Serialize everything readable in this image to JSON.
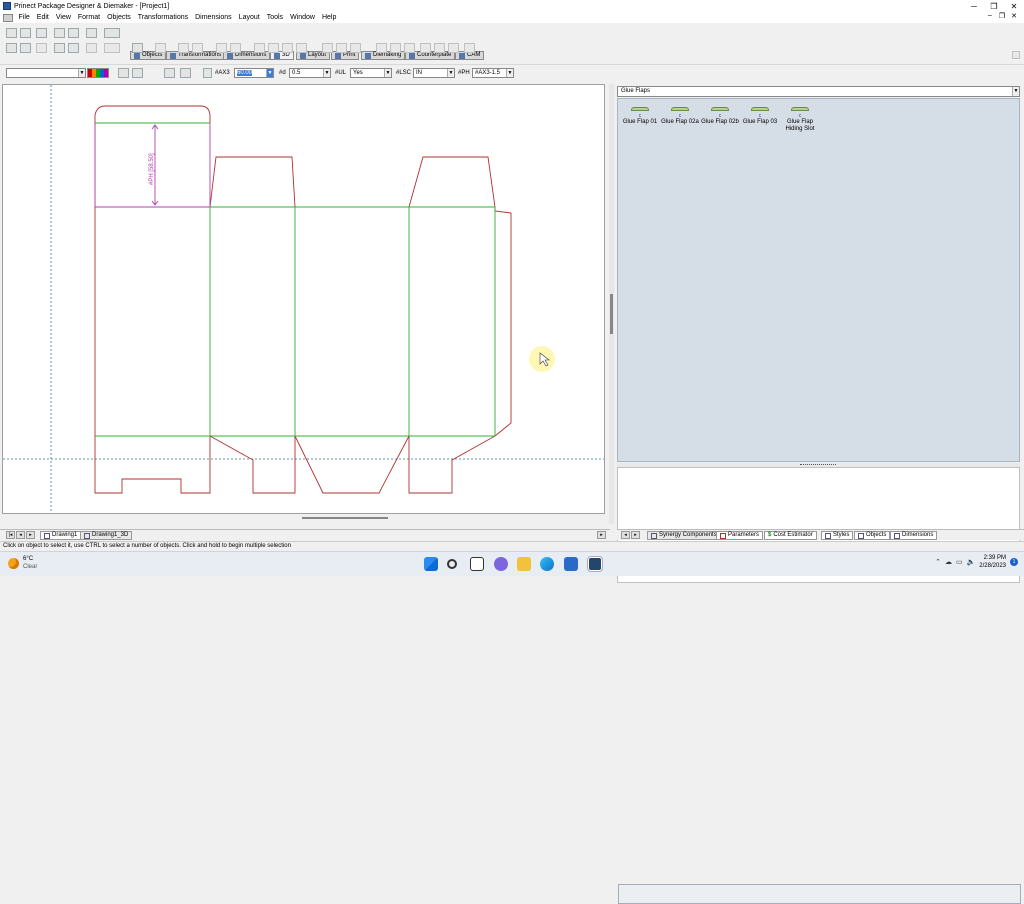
{
  "window": {
    "title": "Prinect Package Designer & Diemaker - [Project1]",
    "controls": [
      "─",
      "❐",
      "✕"
    ]
  },
  "menubar": {
    "items": [
      "File",
      "Edit",
      "View",
      "Format",
      "Objects",
      "Transformations",
      "Dimensions",
      "Layout",
      "Tools",
      "Window",
      "Help"
    ],
    "mdi_controls": [
      "–",
      "❐",
      "✕"
    ]
  },
  "ribbon_tabs": [
    {
      "label": "Objects",
      "icon": "objects-icon"
    },
    {
      "label": "Transformations",
      "icon": "transformations-icon"
    },
    {
      "label": "Dimensions",
      "icon": "dimensions-icon"
    },
    {
      "label": "3D",
      "icon": "3d-icon"
    },
    {
      "label": "Layout",
      "icon": "layout-icon"
    },
    {
      "label": "Print",
      "icon": "print-icon"
    },
    {
      "label": "Diemaking",
      "icon": "diemaking-icon"
    },
    {
      "label": "Counterplate",
      "icon": "counterplate-icon"
    },
    {
      "label": "CAM",
      "icon": "cam-icon"
    }
  ],
  "properties": {
    "ax3_label": "#AX3",
    "ax3_value": "60.00",
    "id_label": "#d",
    "id_value": "0.5",
    "ul_label": "#UL",
    "ul_value": "Yes",
    "lsc_label": "#LSC",
    "lsc_value": "IN",
    "ph_label": "#PH",
    "ph_value": "#AX3-1.5"
  },
  "drawing": {
    "dimension_label": "#PH [58.50]",
    "cut_color": "#b03030",
    "crease_color": "#30b030",
    "dimension_color": "#b040b0",
    "guide_color": "#2a7a9a"
  },
  "bottom_tabs": [
    {
      "label": "Drawing1",
      "icon": "drawing-icon"
    },
    {
      "label": "Drawing1_3D",
      "icon": "drawing-3d-icon"
    }
  ],
  "right_panel": {
    "dropdown": "Glue Flaps",
    "items": [
      {
        "label": "Glue Flap 01",
        "badge": "c"
      },
      {
        "label": "Glue Flap 02a",
        "badge": "c"
      },
      {
        "label": "Glue Flap 02b",
        "badge": "c"
      },
      {
        "label": "Glue Flap 03",
        "badge": "c"
      },
      {
        "label": "Glue Flap Hiding Slot",
        "badge": "c"
      }
    ]
  },
  "right_tabs": [
    {
      "label": "Synergy Components",
      "icon": "synergy-icon"
    },
    {
      "label": "Parameters",
      "icon": "parameters-icon"
    },
    {
      "label": "Cost Estimator",
      "icon": "cost-icon"
    },
    {
      "label": "Styles",
      "icon": "styles-icon"
    },
    {
      "label": "Objects",
      "icon": "objects-icon"
    },
    {
      "label": "Dimensions",
      "icon": "dimensions-icon"
    }
  ],
  "statusbar": {
    "text": "Click on object to select it, use CTRL to select a number of objects. Click and hold to begin multiple selection"
  },
  "taskbar": {
    "weather_temp": "6°C",
    "weather_cond": "Clear",
    "time": "2:39 PM",
    "date": "2/28/2023",
    "notification_count": "1",
    "pinned": [
      "windows-start-icon",
      "search-icon",
      "task-view-icon",
      "chat-icon",
      "file-explorer-icon",
      "edge-icon",
      "store-icon",
      "prinect-icon"
    ]
  }
}
